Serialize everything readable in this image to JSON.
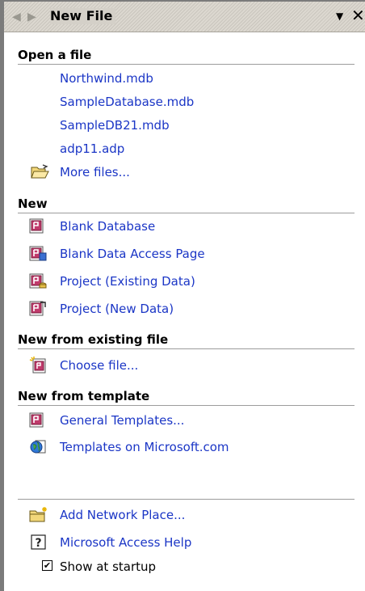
{
  "pane": {
    "title": "New File",
    "back_glyph": "◀",
    "forward_glyph": "▶",
    "dropdown_glyph": "▼",
    "close_glyph": "✕"
  },
  "open_section": {
    "heading": "Open a file",
    "recent_files": [
      "Northwind.mdb",
      "SampleDatabase.mdb",
      "SampleDB21.mdb",
      "adp11.adp"
    ],
    "more_files": "More files..."
  },
  "new_section": {
    "heading": "New",
    "items": [
      "Blank Database",
      "Blank Data Access Page",
      "Project (Existing Data)",
      "Project (New Data)"
    ]
  },
  "existing_section": {
    "heading": "New from existing file",
    "choose_file": "Choose file..."
  },
  "template_section": {
    "heading": "New from template",
    "general_templates": "General Templates...",
    "ms_templates": "Templates on Microsoft.com"
  },
  "footer": {
    "add_network_place": "Add Network Place...",
    "help": "Microsoft Access Help",
    "show_at_startup": "Show at startup",
    "show_at_startup_checked": true,
    "check_glyph": "✔"
  },
  "colors": {
    "link": "#1b36c6",
    "frame": "#7b7b7b"
  }
}
